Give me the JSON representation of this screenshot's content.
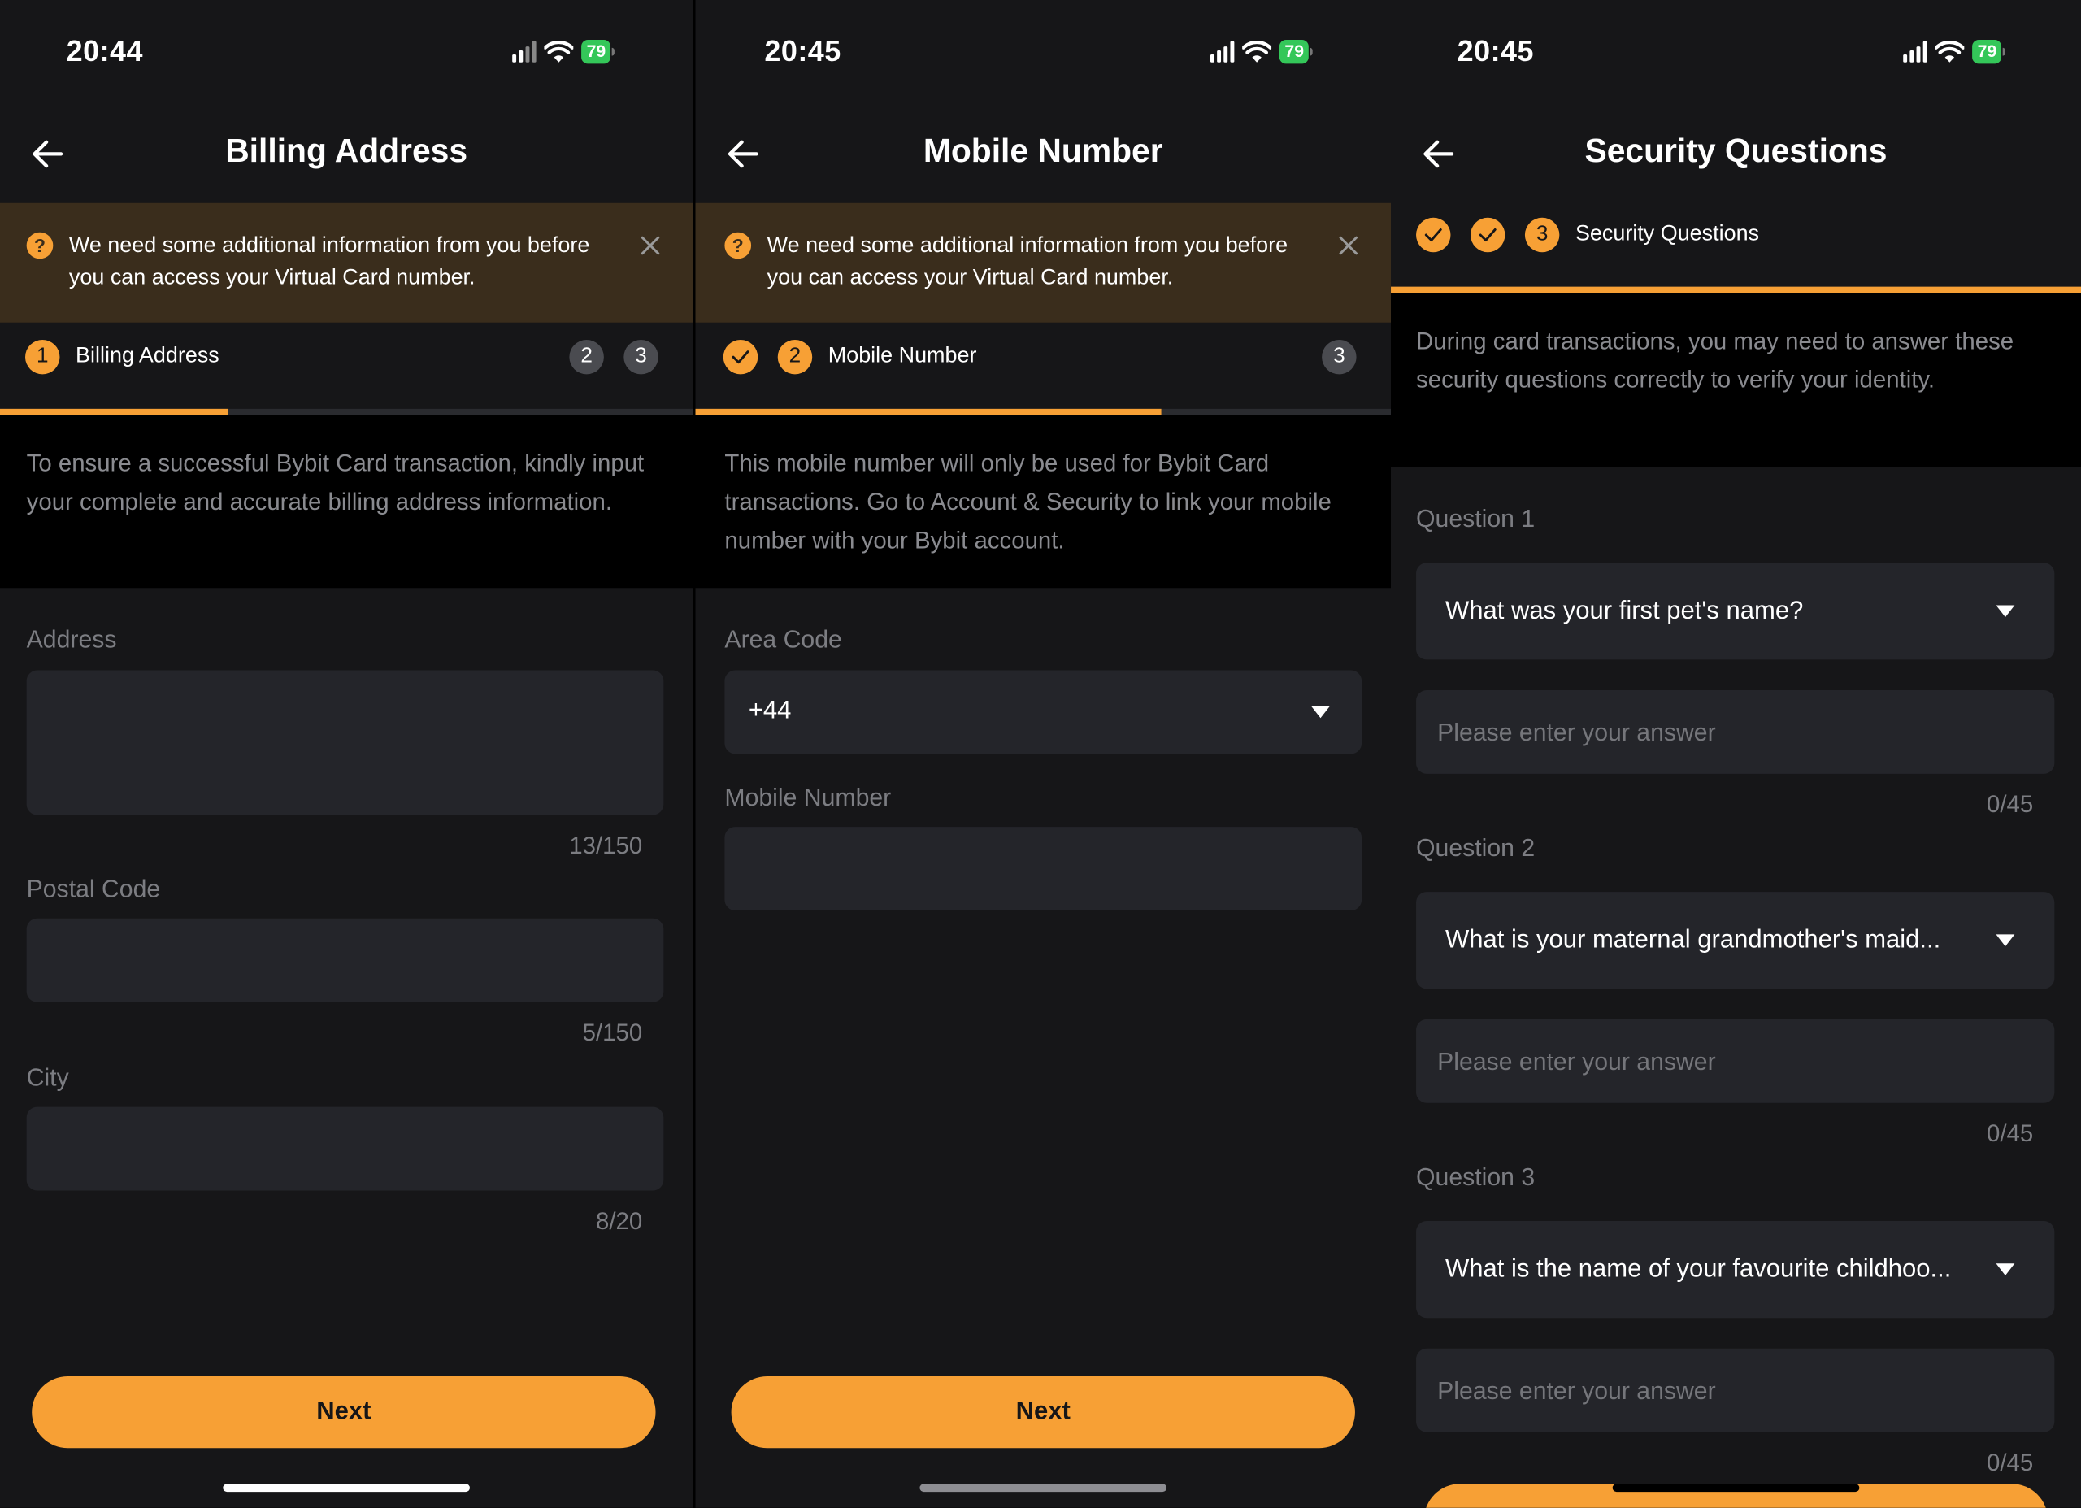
{
  "screens": {
    "billing": {
      "time": "20:44",
      "battery": "79",
      "title": "Billing Address",
      "notice": "We need some additional information from you before you can access your Virtual Card number.",
      "steps": [
        {
          "label": "1"
        },
        {
          "label": "2"
        },
        {
          "label": "3"
        }
      ],
      "active_step_label": "Billing Address",
      "progress": 0.33,
      "description": "To ensure a successful Bybit Card transaction, kindly input your complete and accurate billing address information.",
      "fields": {
        "address": {
          "label": "Address",
          "counter": "13/150"
        },
        "postal": {
          "label": "Postal Code",
          "counter": "5/150"
        },
        "city": {
          "label": "City",
          "counter": "8/20"
        }
      },
      "next_label": "Next"
    },
    "mobile": {
      "time": "20:45",
      "battery": "79",
      "title": "Mobile Number",
      "notice": "We need some additional information from you before you can access your Virtual Card number.",
      "steps": [
        {
          "label": "✓"
        },
        {
          "label": "2"
        },
        {
          "label": "3"
        }
      ],
      "active_step_label": "Mobile Number",
      "progress": 0.67,
      "description": "This mobile number will only be used for Bybit Card transactions. Go to Account & Security to link your mobile number with your Bybit account.",
      "fields": {
        "area_code": {
          "label": "Area Code",
          "value": "+44"
        },
        "mobile": {
          "label": "Mobile Number"
        }
      },
      "next_label": "Next"
    },
    "security": {
      "time": "20:45",
      "battery": "79",
      "title": "Security Questions",
      "active_step_number": "3",
      "active_step_label": "Security Questions",
      "progress": 1.0,
      "description": "During card transactions, you may need to answer these security questions correctly to verify your identity.",
      "questions": [
        {
          "label": "Question 1",
          "question": "What was your first pet's name?",
          "placeholder": "Please enter your answer",
          "counter": "0/45"
        },
        {
          "label": "Question 2",
          "question": "What is your maternal grandmother's maid...",
          "placeholder": "Please enter your answer",
          "counter": "0/45"
        },
        {
          "label": "Question 3",
          "question": "What is the name of your favourite childhoo...",
          "placeholder": "Please enter your answer",
          "counter": "0/45"
        }
      ]
    }
  },
  "colors": {
    "accent": "#f7a035",
    "background": "#161618",
    "field": "#24252a",
    "notice_bg": "#3a2d1c",
    "battery": "#34c759"
  },
  "icons": [
    "back-arrow-icon",
    "question-circle-icon",
    "close-icon",
    "check-icon",
    "caret-down-icon",
    "signal-icon",
    "wifi-icon",
    "battery-icon"
  ]
}
